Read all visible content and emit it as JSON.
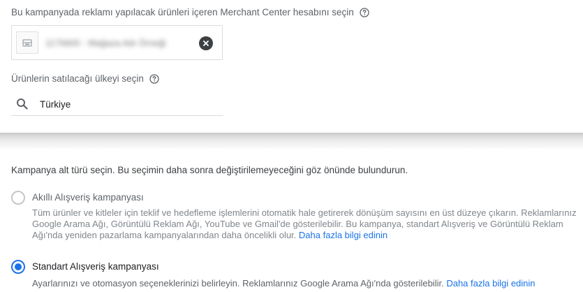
{
  "merchant_center": {
    "label": "Bu kampanyada reklamı yapılacak ürünleri içeren Merchant Center hesabını seçin",
    "account_text": "1176600 - Mağaza Adı Örneği",
    "help_icon": "help-circle-icon",
    "clear_icon": "clear-circle-icon"
  },
  "country": {
    "label": "Ürünlerin satılacağı ülkeyi seçin",
    "value": "Türkiye",
    "search_icon": "search-icon"
  },
  "subtype": {
    "title": "Kampanya alt türü seçin. Bu seçimin daha sonra değiştirilemeyeceğini göz önünde bulundurun.",
    "options": [
      {
        "label": "Akıllı Alışveriş kampanyası",
        "selected": false,
        "description": "Tüm ürünler ve kitleler için teklif ve hedefleme işlemlerini otomatik hale getirerek dönüşüm sayısını en üst düzeye çıkarın. Reklamlarınız Google Arama Ağı, Görüntülü Reklam Ağı, YouTube ve Gmail'de gösterilebilir. Bu kampanya, standart Alışveriş ve Görüntülü Reklam Ağı'nda yeniden pazarlama kampanyalarından daha öncelikli olur.",
        "link": "Daha fazla bilgi edinin"
      },
      {
        "label": "Standart Alışveriş kampanyası",
        "selected": true,
        "description": "Ayarlarınızı ve otomasyon seçeneklerinizi belirleyin. Reklamlarınız Google Arama Ağı'nda gösterilebilir.",
        "link": "Daha fazla bilgi edinin"
      }
    ]
  },
  "colors": {
    "accent": "#1a73e8",
    "text_primary": "#202124",
    "text_secondary": "#5f6368",
    "text_disabled": "#80868b"
  }
}
